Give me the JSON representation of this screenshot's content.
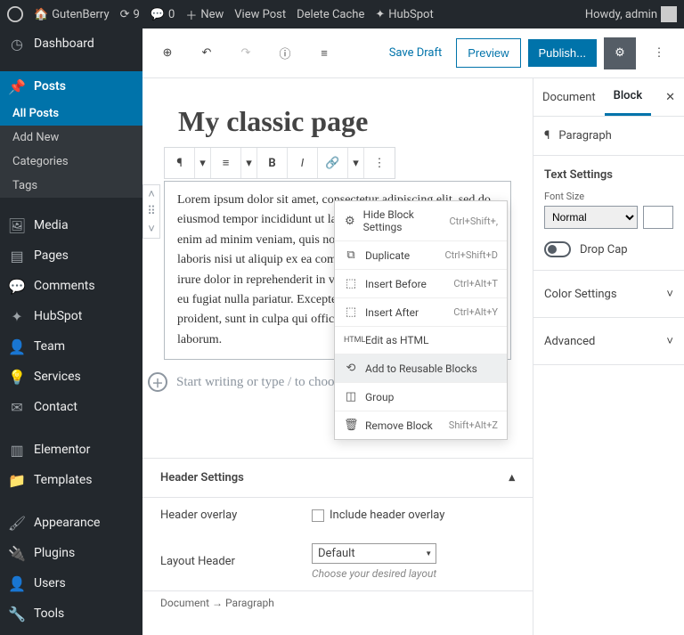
{
  "topbar": {
    "site": "GutenBerry",
    "updates": "9",
    "comments": "0",
    "new": "New",
    "view_post": "View Post",
    "delete_cache": "Delete Cache",
    "hubspot": "HubSpot",
    "howdy": "Howdy, admin"
  },
  "sidebar": {
    "dashboard": "Dashboard",
    "posts": "Posts",
    "all_posts": "All Posts",
    "add_new": "Add New",
    "categories": "Categories",
    "tags": "Tags",
    "media": "Media",
    "pages": "Pages",
    "comments": "Comments",
    "hubspot": "HubSpot",
    "team": "Team",
    "services": "Services",
    "contact": "Contact",
    "elementor": "Elementor",
    "templates": "Templates",
    "appearance": "Appearance",
    "plugins": "Plugins",
    "users": "Users",
    "tools": "Tools"
  },
  "editor": {
    "save_draft": "Save Draft",
    "preview": "Preview",
    "publish": "Publish...",
    "title": "My classic page",
    "paragraph": "Lorem ipsum dolor sit amet, consectetur adipiscing elit, sed do eiusmod tempor incididunt ut labore et dolore magna aliqua. Ut enim ad minim veniam, quis nostrud exercitation ullamco laboris nisi ut aliquip ex ea commodo consequat. Duis aute irure dolor in reprehenderit in voluptate velit esse cillum dolore eu fugiat nulla pariatur. Excepteur sint occaecat cupidatat non proident, sunt in culpa qui officia deserunt mollit anim id est laborum.",
    "placeholder": "Start writing or type / to choose a block"
  },
  "dropdown": {
    "hide": "Hide Block Settings",
    "hide_short": "Ctrl+Shift+,",
    "duplicate": "Duplicate",
    "duplicate_short": "Ctrl+Shift+D",
    "insert_before": "Insert Before",
    "insert_before_short": "Ctrl+Alt+T",
    "insert_after": "Insert After",
    "insert_after_short": "Ctrl+Alt+Y",
    "edit_html": "Edit as HTML",
    "add_reusable": "Add to Reusable Blocks",
    "group": "Group",
    "remove": "Remove Block",
    "remove_short": "Shift+Alt+Z"
  },
  "meta": {
    "header_settings": "Header Settings",
    "header_overlay": "Header overlay",
    "include_overlay": "Include header overlay",
    "layout_header": "Layout Header",
    "default": "Default",
    "hint": "Choose your desired layout"
  },
  "breadcrumb": {
    "document": "Document",
    "arrow": "→",
    "paragraph": "Paragraph"
  },
  "rpanel": {
    "document": "Document",
    "block": "Block",
    "paragraph": "Paragraph",
    "text_settings": "Text Settings",
    "font_size": "Font Size",
    "font_value": "Normal",
    "drop_cap": "Drop Cap",
    "color_settings": "Color Settings",
    "advanced": "Advanced"
  }
}
